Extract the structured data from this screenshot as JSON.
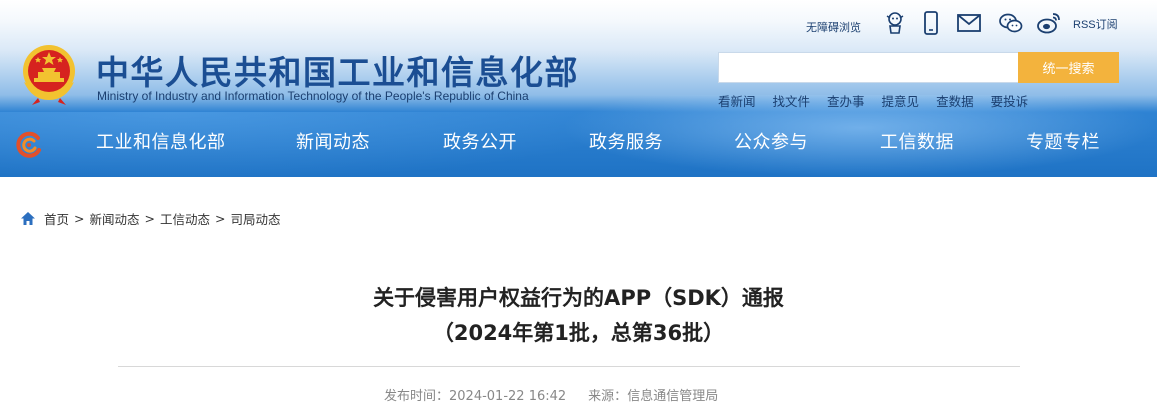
{
  "header": {
    "site_title": "中华人民共和国工业和信息化部",
    "site_subtitle": "Ministry of Industry and Information Technology of the People's Republic of China",
    "accessibility_label": "无障碍浏览",
    "rss_label": "RSS订阅",
    "icons": [
      "robot-icon",
      "mobile-icon",
      "mail-icon",
      "wechat-icon",
      "weibo-icon"
    ]
  },
  "search": {
    "placeholder": "",
    "button_label": "统一搜索",
    "quick_links": [
      "看新闻",
      "找文件",
      "查办事",
      "提意见",
      "查数据",
      "要投诉"
    ]
  },
  "nav": {
    "items": [
      "工业和信息化部",
      "新闻动态",
      "政务公开",
      "政务服务",
      "公众参与",
      "工信数据",
      "专题专栏"
    ]
  },
  "breadcrumb": {
    "items": [
      "首页",
      "新闻动态",
      "工信动态",
      "司局动态"
    ],
    "separator": ">"
  },
  "article": {
    "title_line1": "关于侵害用户权益行为的APP（SDK）通报",
    "title_line2": "（2024年第1批，总第36批）",
    "publish_label": "发布时间：",
    "publish_time": "2024-01-22 16:42",
    "source_label": "来源：",
    "source": "信息通信管理局"
  },
  "colors": {
    "brand_blue": "#1b4e93",
    "nav_blue": "#2f83d3",
    "search_button": "#f3b33d"
  }
}
